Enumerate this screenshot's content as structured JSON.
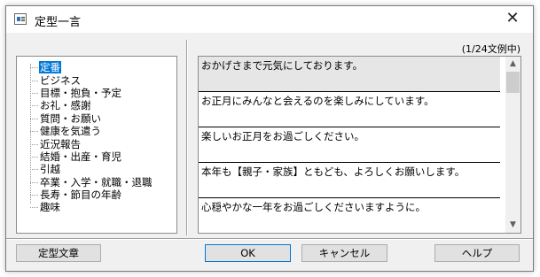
{
  "window": {
    "title": "定型一言",
    "close_glyph": "✕"
  },
  "count_label": "(1/24文例中)",
  "tree": {
    "items": [
      {
        "label": "定番",
        "selected": true
      },
      {
        "label": "ビジネス"
      },
      {
        "label": "目標・抱負・予定"
      },
      {
        "label": "お礼・感謝"
      },
      {
        "label": "質問・お願い"
      },
      {
        "label": "健康を気遣う"
      },
      {
        "label": "近況報告"
      },
      {
        "label": "結婚・出産・育児"
      },
      {
        "label": "引越"
      },
      {
        "label": "卒業・入学・就職・退職"
      },
      {
        "label": "長寿・節目の年齢"
      },
      {
        "label": "趣味"
      }
    ]
  },
  "phrases": {
    "items": [
      {
        "text": "おかげさまで元気にしております。",
        "selected": true
      },
      {
        "text": "お正月にみんなと会えるのを楽しみにしています。"
      },
      {
        "text": "楽しいお正月をお過ごしください。"
      },
      {
        "text": "本年も【親子・家族】ともども、よろしくお願いします。"
      },
      {
        "text": "心穏やかな一年をお過ごしくださいますように。"
      }
    ]
  },
  "scrollbar": {
    "up_glyph": "▲",
    "down_glyph": "▼"
  },
  "buttons": {
    "template": "定型文章",
    "ok": "OK",
    "cancel": "キャンセル",
    "help": "ヘルプ"
  },
  "colors": {
    "selection": "#0078d7",
    "window_bg": "#f0f0f0",
    "selected_row": "#e6e6e6"
  }
}
